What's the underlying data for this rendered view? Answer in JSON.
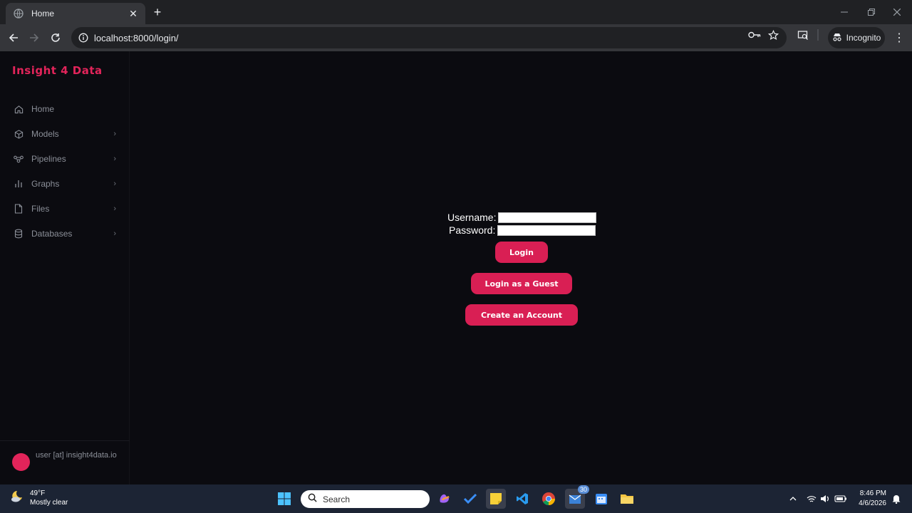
{
  "browser": {
    "tab_title": "Home",
    "url": "localhost:8000/login/",
    "incognito_label": "Incognito"
  },
  "sidebar": {
    "brand": "Insight 4 Data",
    "items": [
      {
        "label": "Home",
        "icon": "home-icon",
        "has_children": false
      },
      {
        "label": "Models",
        "icon": "cube-icon",
        "has_children": true
      },
      {
        "label": "Pipelines",
        "icon": "pipeline-icon",
        "has_children": true
      },
      {
        "label": "Graphs",
        "icon": "bar-chart-icon",
        "has_children": true
      },
      {
        "label": "Files",
        "icon": "file-icon",
        "has_children": true
      },
      {
        "label": "Databases",
        "icon": "database-icon",
        "has_children": true
      }
    ],
    "user_email": "user [at] insight4data.io"
  },
  "login": {
    "username_label": "Username:",
    "username_value": "",
    "password_label": "Password:",
    "password_value": "",
    "login_button": "Login",
    "guest_button": "Login as a Guest",
    "create_account_button": "Create an Account"
  },
  "taskbar": {
    "weather_temp": "49°F",
    "weather_desc": "Mostly clear",
    "search_placeholder": "Search",
    "mail_badge": "30",
    "time": "8:46 PM",
    "date": "4/6/2026"
  },
  "colors": {
    "accent": "#d91f54",
    "brand": "#e2245a",
    "page_bg": "#0b0b10",
    "taskbar_bg": "#1c2434"
  }
}
